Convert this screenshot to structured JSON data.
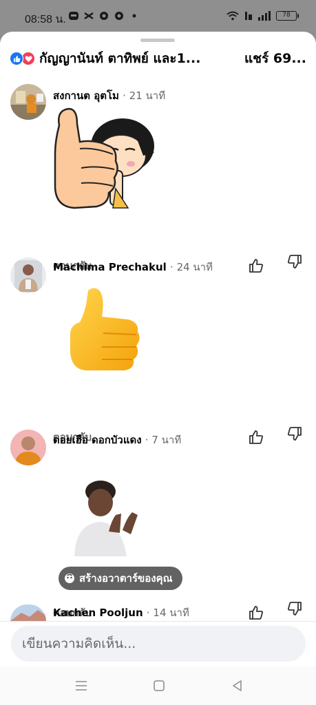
{
  "status_bar": {
    "time": "08:58 น.",
    "left_icons": [
      "line-icon",
      "capcut-icon",
      "chrome-icon",
      "chrome-icon",
      "dot-icon"
    ],
    "right_icons": [
      "wifi-icon",
      "volte-icon",
      "signal-icon"
    ],
    "battery": "78"
  },
  "header": {
    "reactions": [
      "like",
      "love"
    ],
    "names": "กัญญานันท์ ตาทิพย์ และ1...",
    "shares": "แชร์ 69..."
  },
  "comments": [
    {
      "author": "สงกานต อุตโม",
      "time": "· 21 นาที",
      "content_type": "sticker",
      "reply_label": "ตอบกลับ"
    },
    {
      "author": "Machima Prechakul",
      "time": "· 24 นาที",
      "content_type": "thumbs-up-emoji",
      "reply_label": "ตอบกลับ"
    },
    {
      "author": "ดอยเฮือ ดอกบัวแดง",
      "time": "· 7 นาที",
      "content_type": "avatar-sticker",
      "avatar_cta": "สร้างอวาตาร์ของคุณ",
      "reply_label": "ตอบกลับ"
    },
    {
      "author": "Kachen Pooljun",
      "time": "· 14 นาที"
    }
  ],
  "composer": {
    "placeholder": "เขียนความคิดเห็น..."
  },
  "nav_bar": {
    "buttons": [
      "menu-icon",
      "home-icon",
      "back-icon"
    ]
  },
  "colors": {
    "like_blue": "#1877f2",
    "love_red": "#f33e58",
    "meta_gray": "#65676b",
    "composer_bg": "#f0f2f5"
  }
}
